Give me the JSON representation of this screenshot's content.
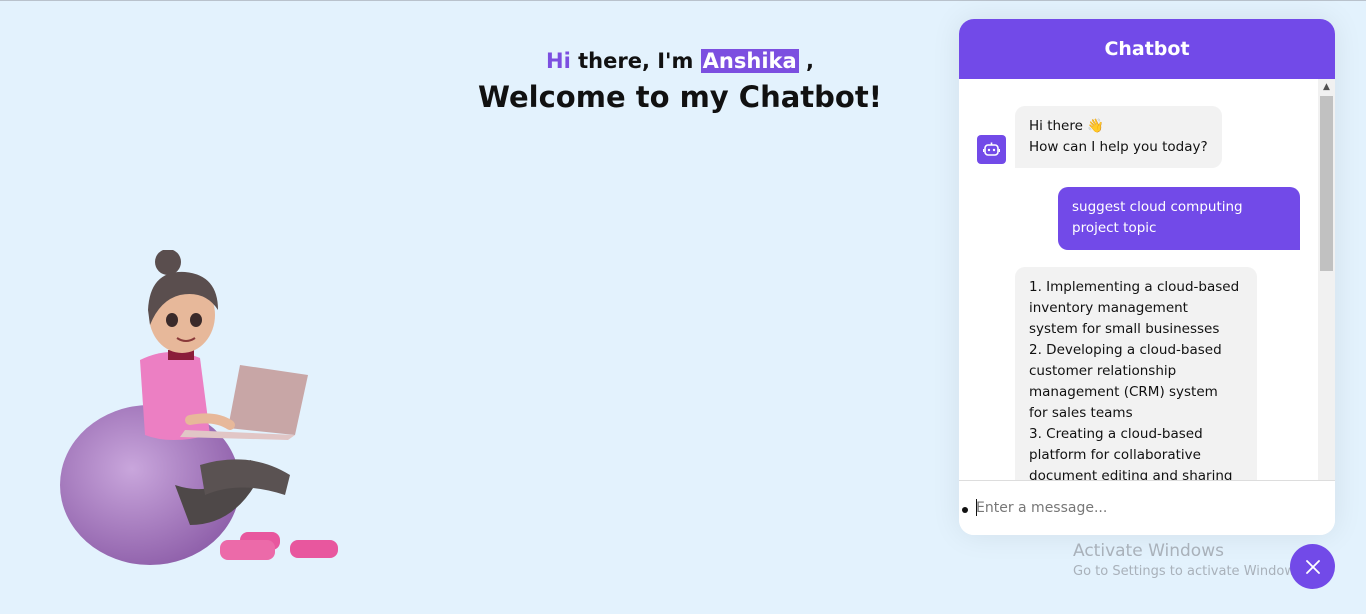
{
  "hero": {
    "greeting_hi": "Hi",
    "greeting_mid": " there, I'm ",
    "name": "Anshika",
    "greeting_end": " ,",
    "welcome": "Welcome to my Chatbot!"
  },
  "chat": {
    "title": "Chatbot",
    "messages": [
      {
        "role": "bot",
        "text": "Hi there 👋\nHow can I help you today?"
      },
      {
        "role": "user",
        "text": "suggest cloud computing\nproject topic"
      },
      {
        "role": "bot",
        "text": "1. Implementing a cloud-based\ninventory management\nsystem for small businesses\n2. Developing a cloud-based\ncustomer relationship\nmanagement (CRM) system\nfor sales teams\n3. Creating a cloud-based\nplatform for collaborative\ndocument editing and sharing"
      }
    ],
    "input_placeholder": "Enter a message..."
  },
  "watermark": {
    "line1": "Activate Windows",
    "line2": "Go to Settings to activate Windows."
  },
  "colors": {
    "accent": "#724ae8",
    "background": "#e3f2fd"
  },
  "icons": {
    "bot_avatar": "robot-icon",
    "close": "close-icon"
  }
}
